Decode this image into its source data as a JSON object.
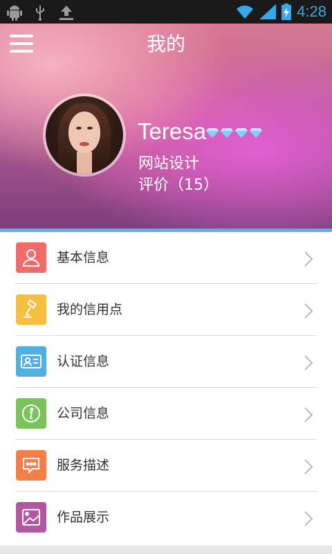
{
  "status_bar": {
    "time": "4:28",
    "icons": [
      "android-icon",
      "usb-icon",
      "download-icon",
      "wifi-icon",
      "signal-icon",
      "battery-charging-icon"
    ]
  },
  "header": {
    "title": "我的",
    "menu_icon": "hamburger-menu-icon"
  },
  "profile": {
    "name": "Teresa",
    "diamond_count": 4,
    "job": "网站设计",
    "rating_text": "评价（15）"
  },
  "menu": {
    "items": [
      {
        "label": "基本信息",
        "icon": "user-icon",
        "color": "#f26a6a"
      },
      {
        "label": "我的信用点",
        "icon": "gavel-icon",
        "color": "#f6bf3f"
      },
      {
        "label": "认证信息",
        "icon": "id-card-icon",
        "color": "#4fb0e2"
      },
      {
        "label": "公司信息",
        "icon": "info-icon",
        "color": "#7ac35a"
      },
      {
        "label": "服务描述",
        "icon": "chat-bubble-icon",
        "color": "#f87d46"
      },
      {
        "label": "作品展示",
        "icon": "picture-icon",
        "color": "#b1569f"
      }
    ]
  },
  "colors": {
    "accent_stripe": "#6ea6e8",
    "divider": "#d9d9d9",
    "status_time": "#37a8ea"
  }
}
